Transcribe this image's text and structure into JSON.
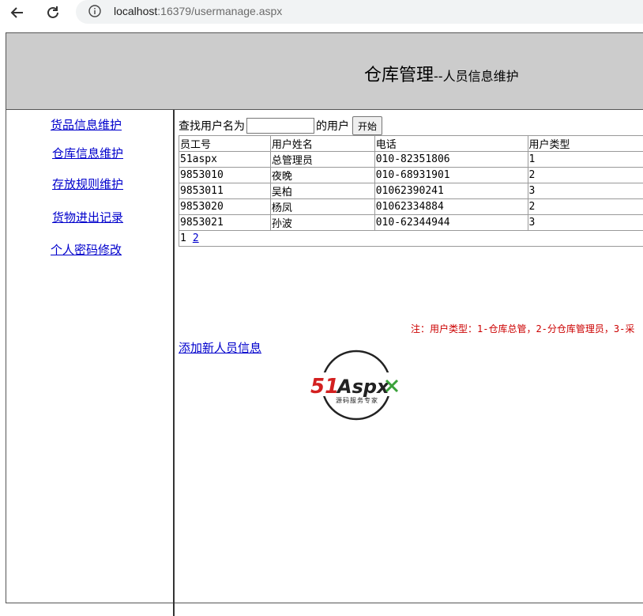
{
  "browser": {
    "url_host": "localhost",
    "url_rest": ":16379/usermanage.aspx"
  },
  "header": {
    "title_main": "仓库管理",
    "title_sub": "--人员信息维护"
  },
  "sidebar": {
    "items": [
      {
        "label": "货品信息维护"
      },
      {
        "label": "仓库信息维护"
      },
      {
        "label": "存放规则维护"
      },
      {
        "label": "货物进出记录"
      },
      {
        "label": "个人密码修改"
      }
    ]
  },
  "search": {
    "prefix": "查找用户名为",
    "suffix": "的用户",
    "input_value": "",
    "button_label": "开始"
  },
  "table": {
    "columns": [
      "员工号",
      "用户姓名",
      "电话",
      "用户类型"
    ],
    "rows": [
      [
        "51aspx",
        "总管理员",
        "010-82351806",
        "1"
      ],
      [
        "9853010",
        "夜晚",
        "010-68931901",
        "2"
      ],
      [
        "9853011",
        "吴柏",
        "01062390241",
        "3"
      ],
      [
        "9853020",
        "杨凤",
        "01062334884",
        "2"
      ],
      [
        "9853021",
        "孙波",
        "010-62344944",
        "3"
      ]
    ],
    "pager": {
      "current": "1",
      "next": "2"
    }
  },
  "note": "注：用户类型：1-仓库总管，2-分仓库管理员，3-采",
  "add_link": "添加新人员信息",
  "logo": {
    "text": "51Aspx",
    "tagline": "源码服务专家"
  },
  "colors": {
    "header_bg": "#cccccc",
    "link": "#0000cc",
    "note": "#cc0000"
  }
}
